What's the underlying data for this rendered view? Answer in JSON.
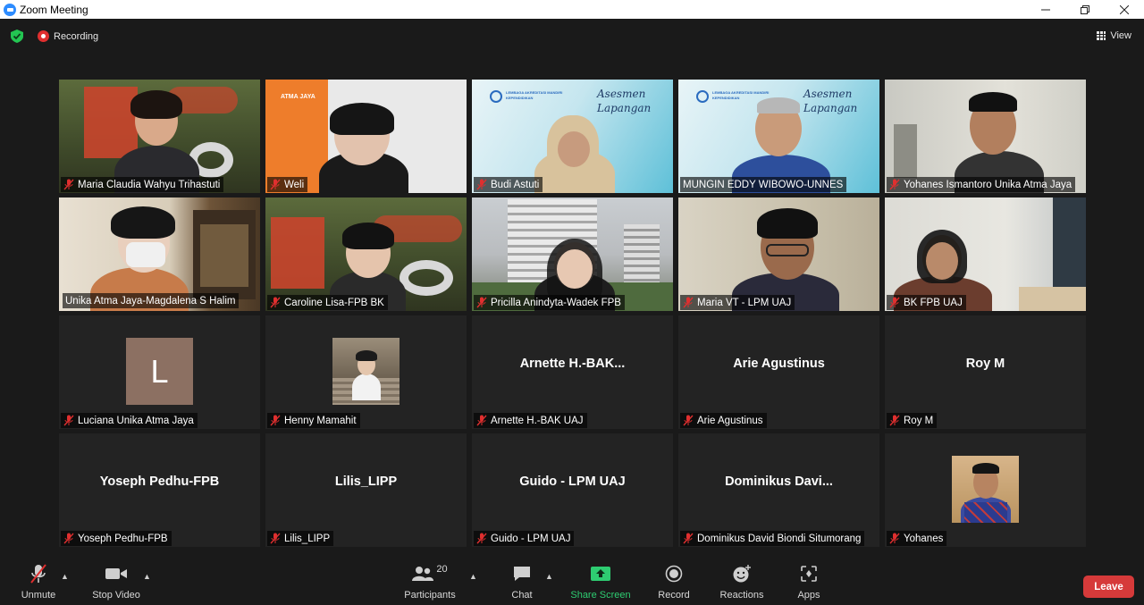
{
  "window": {
    "title": "Zoom Meeting"
  },
  "status": {
    "recording_label": "Recording",
    "view_label": "View"
  },
  "tiles": [
    {
      "name": "Maria Claudia Wahyu Trihastuti"
    },
    {
      "name": "Weli"
    },
    {
      "name": "Budi Astuti"
    },
    {
      "name": "MUNGIN EDDY WIBOWO-UNNES"
    },
    {
      "name": "Yohanes Ismantoro Unika Atma Jaya"
    },
    {
      "name": "Unika Atma Jaya-Magdalena S Halim"
    },
    {
      "name": "Caroline Lisa-FPB BK"
    },
    {
      "name": "Pricilla Anindyta-Wadek FPB"
    },
    {
      "name": "Maria VT - LPM UAJ"
    },
    {
      "name": "BK FPB UAJ"
    },
    {
      "name": "Luciana  Unika Atma Jaya",
      "avatar_letter": "L"
    },
    {
      "name": "Henny Mamahit"
    },
    {
      "name": "Arnette H.-BAK UAJ",
      "display": "Arnette  H.-BAK..."
    },
    {
      "name": "Arie Agustinus",
      "display": "Arie Agustinus"
    },
    {
      "name": "Roy M",
      "display": "Roy M"
    },
    {
      "name": "Yoseph Pedhu-FPB",
      "display": "Yoseph Pedhu-FPB"
    },
    {
      "name": "Lilis_LIPP",
      "display": "Lilis_LIPP"
    },
    {
      "name": "Guido - LPM UAJ",
      "display": "Guido - LPM UAJ"
    },
    {
      "name": "Dominikus David Biondi Situmorang",
      "display": "Dominikus  Davi..."
    },
    {
      "name": "Yohanes"
    }
  ],
  "backgrounds": {
    "tile_2_banner_text": "ATMA JAYA",
    "tile_3_banner_script": "Asesmen Lapangan",
    "tile_3_banner_org": "LEMBAGA AKREDITASI MANDIRI KEPENDIDIKAN"
  },
  "toolbar": {
    "unmute_label": "Unmute",
    "stop_video_label": "Stop Video",
    "participants_label": "Participants",
    "participants_count": "20",
    "chat_label": "Chat",
    "share_screen_label": "Share Screen",
    "record_label": "Record",
    "reactions_label": "Reactions",
    "apps_label": "Apps",
    "leave_label": "Leave"
  },
  "colors": {
    "background": "#1a1a1a",
    "tile": "#232323",
    "active_speaker": "#e6f05a",
    "recording": "#e02f2f",
    "share_screen": "#2ecc71",
    "leave": "#d63a3a",
    "mic_muted": "#e02f2f"
  }
}
